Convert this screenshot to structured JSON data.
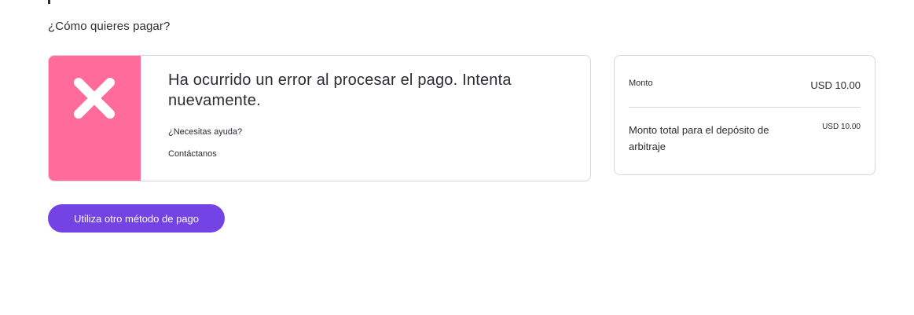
{
  "payment": {
    "question": "¿Cómo quieres pagar?"
  },
  "error_card": {
    "icon": "x-icon",
    "accent_color": "#ff6b9b",
    "title": "Ha ocurrido un error al procesar el pago. Intenta nuevamente.",
    "help_text": "¿Necesitas ayuda?",
    "contact_link": "Contáctanos"
  },
  "summary": {
    "amount_label": "Monto",
    "amount_value": "USD 10.00",
    "total_label": "Monto total para el depósito de arbitraje",
    "total_value": "USD 10.00"
  },
  "actions": {
    "other_method_label": "Utiliza otro método de pago",
    "button_color": "#7443e6"
  }
}
